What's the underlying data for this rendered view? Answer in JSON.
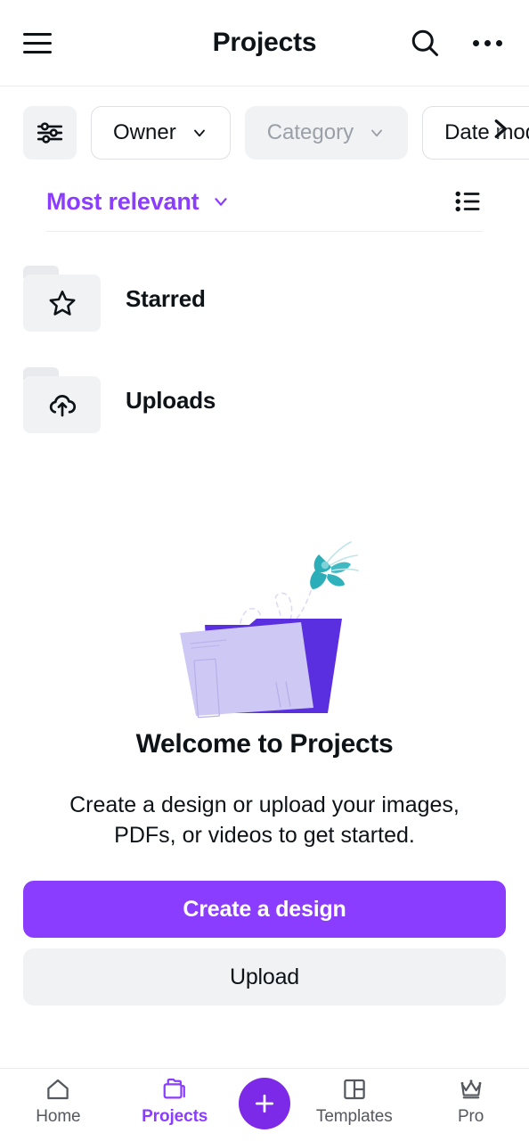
{
  "header": {
    "title": "Projects",
    "menu_icon": "hamburger-menu-icon",
    "search_icon": "search-icon",
    "more_icon": "more-options-icon"
  },
  "filters": {
    "filter_icon": "filter-sliders-icon",
    "chips": [
      {
        "label": "Owner",
        "state": "default"
      },
      {
        "label": "Category",
        "state": "disabled"
      },
      {
        "label": "Date modified",
        "state": "default"
      }
    ],
    "scroll_icon": "chevron-right-icon"
  },
  "sort": {
    "label": "Most relevant",
    "chevron_icon": "chevron-down-icon",
    "view_toggle_icon": "list-view-icon"
  },
  "folders": [
    {
      "name": "Starred",
      "icon": "star-icon"
    },
    {
      "name": "Uploads",
      "icon": "cloud-upload-icon"
    }
  ],
  "empty_state": {
    "illustration": "folder-butterfly-illustration",
    "title": "Welcome to Projects",
    "description": "Create a design or upload your images, PDFs, or videos to get started.",
    "primary_button": "Create a design",
    "secondary_button": "Upload"
  },
  "bottom_nav": {
    "items": [
      {
        "label": "Home",
        "icon": "home-icon",
        "active": false
      },
      {
        "label": "Projects",
        "icon": "folder-icon",
        "active": true
      },
      {
        "label": "Templates",
        "icon": "templates-layout-icon",
        "active": false
      },
      {
        "label": "Pro",
        "icon": "crown-icon",
        "active": false
      }
    ],
    "fab_icon": "plus-icon"
  },
  "colors": {
    "accent_purple": "#8b3dff",
    "fab_purple": "#7d2ae8",
    "text_dark": "#0e1318",
    "muted_gray": "#9b9fa8",
    "surface_gray": "#f1f2f4",
    "illus_dark_purple": "#5a2fe0",
    "illus_light_purple": "#cec8f5",
    "illus_teal": "#2baeb8"
  }
}
